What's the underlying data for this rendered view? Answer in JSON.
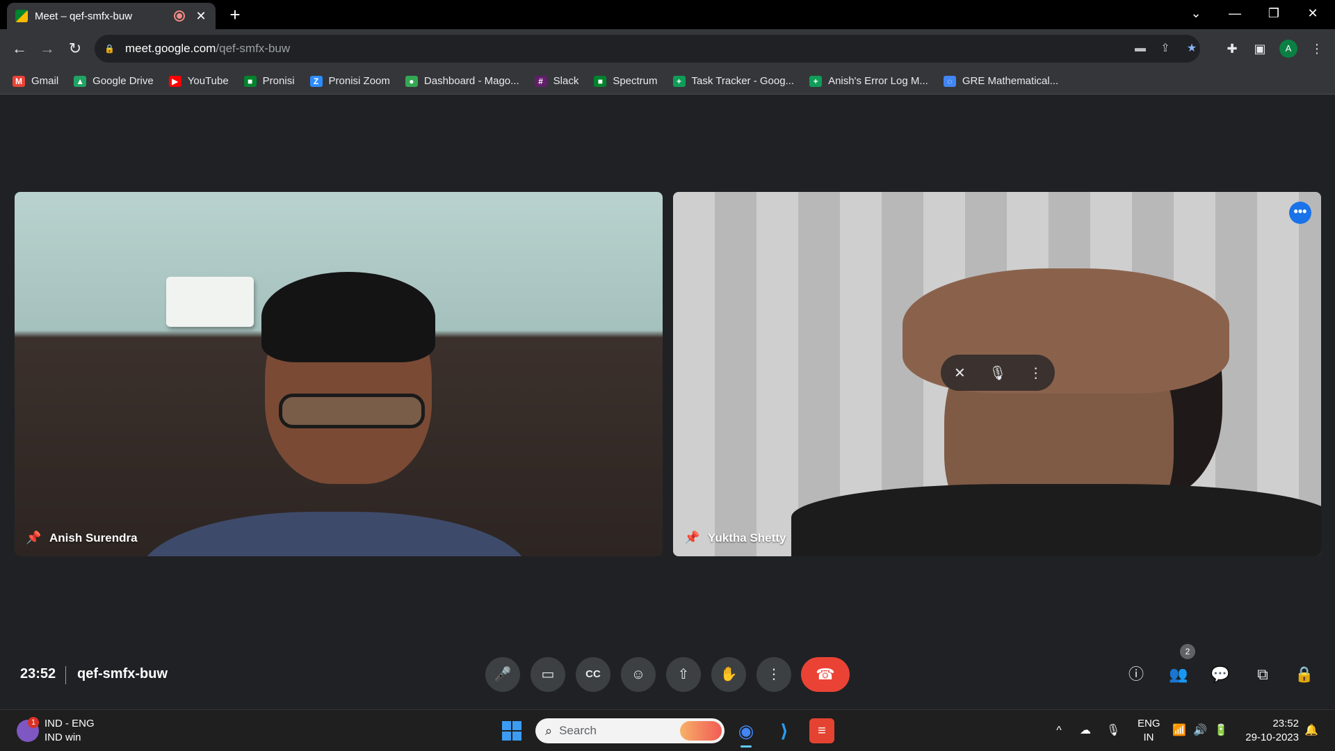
{
  "browser": {
    "tab_title": "Meet – qef-smfx-buw",
    "tab_close": "✕",
    "new_tab": "+",
    "window_controls": {
      "dropdown": "⌄",
      "minimize": "—",
      "restore": "❐",
      "close": "✕"
    },
    "nav": {
      "back": "←",
      "forward": "→",
      "reload": "↻"
    },
    "url_host": "meet.google.com",
    "url_path": "/qef-smfx-buw",
    "lock_icon": "🔒",
    "omnibox_icons": [
      "camera-icon",
      "share-icon",
      "star-icon"
    ],
    "profile_initial": "A"
  },
  "bookmarks": [
    {
      "label": "Gmail",
      "icon": "gmail-icon",
      "color": "#ea4335",
      "glyph": "M"
    },
    {
      "label": "Google Drive",
      "icon": "drive-icon",
      "color": "#1fa463",
      "glyph": "▲"
    },
    {
      "label": "YouTube",
      "icon": "youtube-icon",
      "color": "#ff0000",
      "glyph": "▶"
    },
    {
      "label": "Pronisi",
      "icon": "meet-icon",
      "color": "#00832d",
      "glyph": "■"
    },
    {
      "label": "Pronisi Zoom",
      "icon": "zoom-icon",
      "color": "#2d8cff",
      "glyph": "Z"
    },
    {
      "label": "Dashboard - Mago...",
      "icon": "dashboard-icon",
      "color": "#34a853",
      "glyph": "●"
    },
    {
      "label": "Slack",
      "icon": "slack-icon",
      "color": "#611f69",
      "glyph": "#"
    },
    {
      "label": "Spectrum",
      "icon": "meet-icon",
      "color": "#00832d",
      "glyph": "■"
    },
    {
      "label": "Task Tracker - Goog...",
      "icon": "sheets-icon",
      "color": "#0f9d58",
      "glyph": "+"
    },
    {
      "label": "Anish's Error Log M...",
      "icon": "sheets-icon",
      "color": "#0f9d58",
      "glyph": "+"
    },
    {
      "label": "GRE Mathematical...",
      "icon": "loading-icon",
      "color": "#4285f4",
      "glyph": "◌"
    }
  ],
  "participants": [
    {
      "name": "Anish Surendra",
      "pinned": true
    },
    {
      "name": "Yuktha Shetty",
      "pinned": true
    }
  ],
  "tile_overlay": {
    "more_glyph": "•••",
    "pin_glyph": "✕",
    "mic_glyph": "🎙",
    "menu_glyph": "⋮"
  },
  "meeting": {
    "time": "23:52",
    "code": "qef-smfx-buw",
    "participant_count": "2",
    "controls": [
      {
        "name": "mic-button",
        "glyph": "🎤"
      },
      {
        "name": "camera-button",
        "glyph": "▭"
      },
      {
        "name": "captions-button",
        "glyph": "CC"
      },
      {
        "name": "reactions-button",
        "glyph": "☺"
      },
      {
        "name": "present-button",
        "glyph": "⇧"
      },
      {
        "name": "raise-hand-button",
        "glyph": "✋"
      },
      {
        "name": "more-options-button",
        "glyph": "⋮"
      }
    ],
    "hangup_glyph": "☎",
    "right_controls": [
      {
        "name": "meeting-details-button",
        "glyph": "ⓘ"
      },
      {
        "name": "people-button",
        "glyph": "👥"
      },
      {
        "name": "chat-button",
        "glyph": "💬"
      },
      {
        "name": "activities-button",
        "glyph": "⧉"
      },
      {
        "name": "host-controls-button",
        "glyph": "🔒"
      }
    ]
  },
  "taskbar": {
    "weather_badge": "1",
    "lang_line1": "IND - ENG",
    "lang_line2": "IND win",
    "search_placeholder": "Search",
    "search_glyph": "⌕",
    "apps": [
      {
        "name": "chrome-taskbar-icon",
        "glyph": "◉",
        "color": "#4285f4",
        "active": true
      },
      {
        "name": "vscode-taskbar-icon",
        "glyph": "⟩",
        "color": "#007acc",
        "active": false
      },
      {
        "name": "todoist-taskbar-icon",
        "glyph": "≡",
        "color": "#e44332",
        "active": false
      }
    ],
    "tray_glyphs": {
      "chevron": "^",
      "cloud": "☁",
      "mic": "🎙",
      "wifi": "📶",
      "volume": "🔊",
      "battery": "🔋",
      "bell": "🔔"
    },
    "ime_line1": "ENG",
    "ime_line2": "IN",
    "time": "23:52",
    "date": "29-10-2023"
  }
}
